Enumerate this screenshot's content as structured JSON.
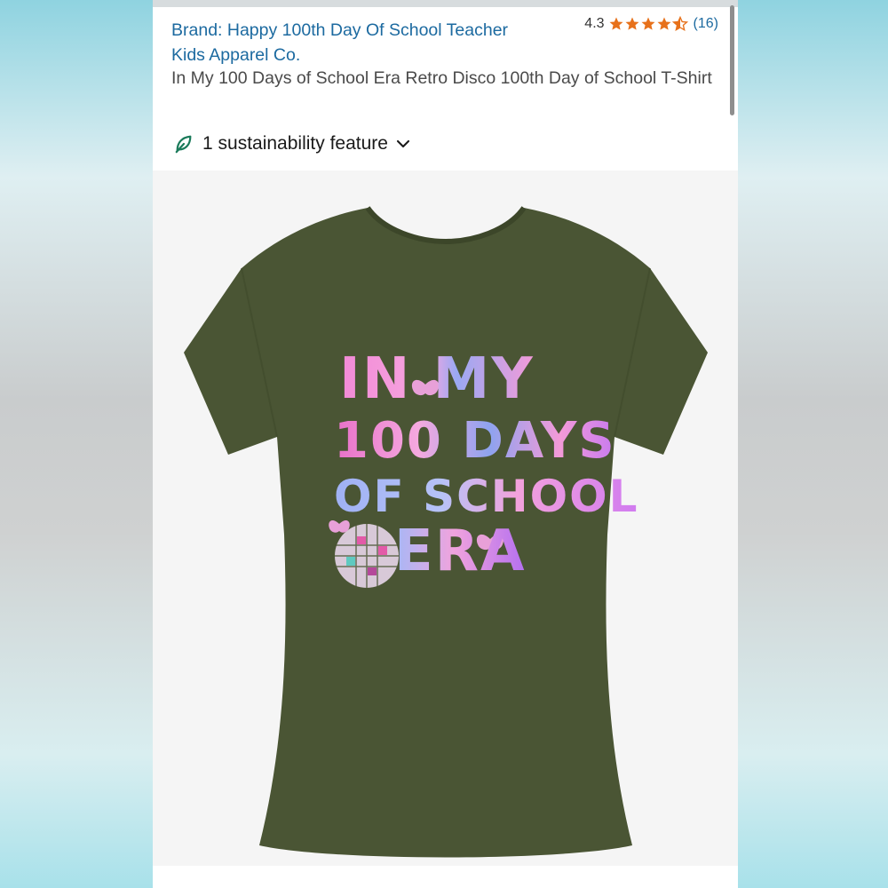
{
  "product": {
    "brand_line": "Brand: Happy 100th Day Of School Teacher Kids Apparel Co.",
    "rating_value": "4.3",
    "rating_stars": 4.3,
    "rating_count": "(16)",
    "title": "In My 100 Days of School Era Retro Disco 100th Day of School T-Shirt",
    "sustainability_label": "1 sustainability feature"
  },
  "image": {
    "shirt_color": "#4a5534",
    "print_lines": [
      "IN MY",
      "100 DAYS",
      "OF SCHOOL",
      "ERA"
    ]
  },
  "colors": {
    "link": "#1c6aa0",
    "star": "#e7711b",
    "leaf": "#1a7a5a"
  },
  "icons": {
    "leaf": "leaf-icon",
    "chevron": "chevron-down-icon",
    "star": "star-icon"
  }
}
